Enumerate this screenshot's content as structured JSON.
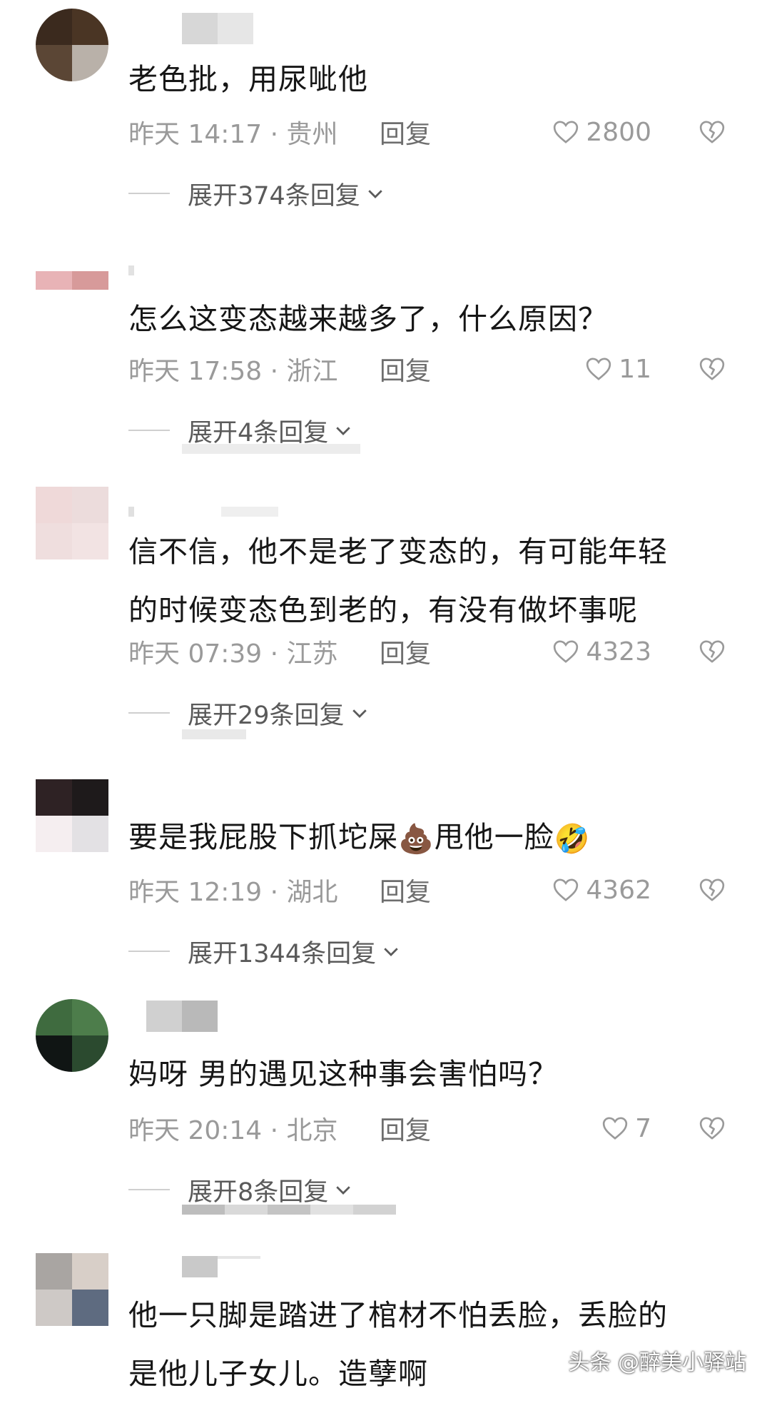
{
  "comments": [
    {
      "text": "老色批，用尿呲他",
      "time": "昨天 14:17 · 贵州",
      "reply_label": "回复",
      "likes": "2800",
      "expand_label": "展开374条回复"
    },
    {
      "text": "怎么这变态越来越多了，什么原因？",
      "time": "昨天 17:58 · 浙江",
      "reply_label": "回复",
      "likes": "11",
      "expand_label": "展开4条回复"
    },
    {
      "text_line1": "信不信，他不是老了变态的，有可能年轻",
      "text_line2": "的时候变态色到老的，有没有做坏事呢",
      "time": "昨天 07:39 · 江苏",
      "reply_label": "回复",
      "likes": "4323",
      "expand_label": "展开29条回复"
    },
    {
      "text_part1": "要是我屁股下抓坨屎",
      "emoji1": "💩",
      "text_part2": "甩他一脸",
      "emoji2": "🤣",
      "time": "昨天 12:19 · 湖北",
      "reply_label": "回复",
      "likes": "4362",
      "expand_label": "展开1344条回复"
    },
    {
      "text": "妈呀 男的遇见这种事会害怕吗？",
      "time": "昨天 20:14 · 北京",
      "reply_label": "回复",
      "likes": "7",
      "expand_label": "展开8条回复"
    },
    {
      "text_line1": "他一只脚是踏进了棺材不怕丢脸，丢脸的",
      "text_line2": "是他儿子女儿。造孽啊"
    }
  ],
  "watermark": "头条 @醉美小驿站",
  "icons": {
    "like": "heart-outline-icon",
    "dislike": "broken-heart-icon",
    "expand": "chevron-down-icon"
  },
  "colors": {
    "text": "#161616",
    "meta": "#9a9a9a",
    "reply": "#6e6e6e"
  }
}
